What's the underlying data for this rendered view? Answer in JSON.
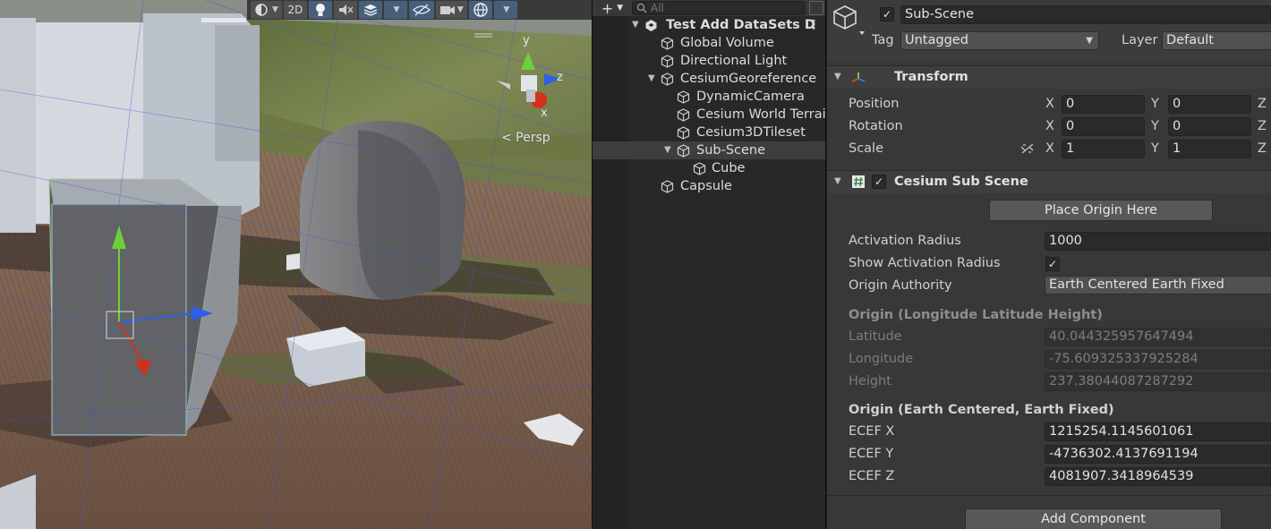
{
  "scene_view": {
    "toolbar": {
      "shading_icon": "shading-mode-icon",
      "mode_2d_label": "2D",
      "lighting_icon": "lightbulb-icon",
      "audio_icon": "audio-mute-icon",
      "effects_icon": "layers-effects-icon",
      "hidden_icon": "eye-slash-icon",
      "camera_icon": "camera-icon",
      "gizmos_icon": "gizmo-globe-icon"
    },
    "gizmo": {
      "y_label": "y",
      "z_label": "z",
      "x_label": "x"
    },
    "persp_label": "< Persp"
  },
  "hierarchy": {
    "add_label": "+",
    "search_placeholder": "All",
    "scene_title": "Test Add DataSets D",
    "menu_dots": "⋮",
    "items": [
      {
        "label": "Global Volume"
      },
      {
        "label": "Directional Light"
      },
      {
        "label": "CesiumGeoreference"
      },
      {
        "label": "DynamicCamera"
      },
      {
        "label": "Cesium World Terrain"
      },
      {
        "label": "Cesium3DTileset"
      },
      {
        "label": "Sub-Scene"
      },
      {
        "label": "Cube"
      },
      {
        "label": "Capsule"
      }
    ]
  },
  "inspector": {
    "object_name": "Sub-Scene",
    "active_checked": "✓",
    "tag_label": "Tag",
    "tag_value": "Untagged",
    "layer_label": "Layer",
    "layer_value": "Default",
    "transform": {
      "title": "Transform",
      "position_label": "Position",
      "rotation_label": "Rotation",
      "scale_label": "Scale",
      "x": "X",
      "y": "Y",
      "z": "Z",
      "position": {
        "x": "0",
        "y": "0"
      },
      "rotation": {
        "x": "0",
        "y": "0"
      },
      "scale": {
        "x": "1",
        "y": "1"
      }
    },
    "subscene": {
      "title": "Cesium Sub Scene",
      "enabled_check": "✓",
      "place_origin_button": "Place Origin Here",
      "activation_radius_label": "Activation Radius",
      "activation_radius_value": "1000",
      "show_activation_label": "Show Activation Radius",
      "show_activation_check": "✓",
      "origin_authority_label": "Origin Authority",
      "origin_authority_value": "Earth Centered Earth Fixed",
      "llh_header": "Origin (Longitude Latitude Height)",
      "latitude_label": "Latitude",
      "latitude_value": "40.044325957647494",
      "longitude_label": "Longitude",
      "longitude_value": "-75.609325337925284",
      "height_label": "Height",
      "height_value": "237.38044087287292",
      "ecef_header": "Origin (Earth Centered, Earth Fixed)",
      "ecef_x_label": "ECEF X",
      "ecef_x_value": "1215254.1145601061",
      "ecef_y_label": "ECEF Y",
      "ecef_y_value": "-4736302.4137691194",
      "ecef_z_label": "ECEF Z",
      "ecef_z_value": "4081907.3418964539"
    },
    "add_component_button": "Add Component"
  }
}
